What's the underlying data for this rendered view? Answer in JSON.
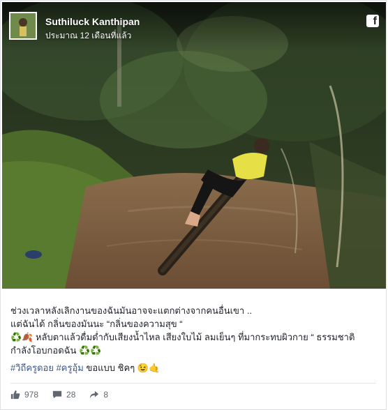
{
  "post": {
    "author": "Suthiluck Kanthipan",
    "timestamp": "ประมาณ 12 เดือนที่แล้ว",
    "network_icon": "facebook-icon",
    "line1": "ช่วงเวลาหลังเลิกงานของฉันมันอาจจะแตกต่างจากคนอื่นเขา ..",
    "line2": "แต่ฉันได้ กลิ่นของมันนะ “กลิ่นของความสุข “",
    "line3_emoji": "♻️🍂",
    "line3_text": " หลับตาแล้วดื่มด่ำกับเสียงน้ำไหล เสียงใบไม้ ลมเย็นๆ ที่มากระทบผิวกาย “ ธรรมชาติ",
    "line4_text": "กำลังโอบกอดฉัน ",
    "line4_emoji": "♻️♻️",
    "hashtag1": "#วิถีครูดอย",
    "hashtag2": "#ครูอุ้ม",
    "line5_text": " ขอแบบ ชิคๆ ",
    "line5_emoji": "😉🤙"
  },
  "stats": {
    "likes": "978",
    "comments": "28",
    "shares": "8",
    "like_icon": "thumbs-up-icon",
    "comment_icon": "comment-icon",
    "share_icon": "share-icon"
  },
  "colors": {
    "hashtag": "#365899",
    "text": "#1d2129",
    "meta": "#606770"
  }
}
